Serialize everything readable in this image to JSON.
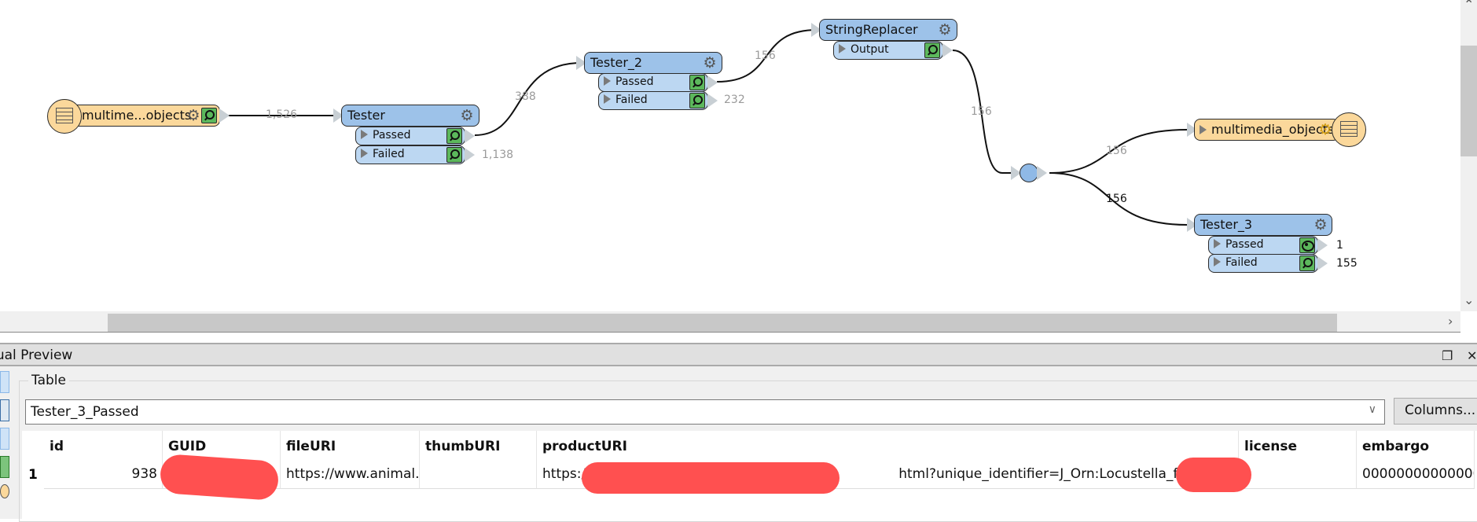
{
  "canvas": {
    "reader": {
      "label": "multime...objects",
      "count_out": "1,526"
    },
    "tester": {
      "label": "Tester",
      "ports": [
        {
          "label": "Passed",
          "count": "388"
        },
        {
          "label": "Failed",
          "count": "1,138"
        }
      ]
    },
    "tester_2": {
      "label": "Tester_2",
      "ports": [
        {
          "label": "Passed",
          "count": "156"
        },
        {
          "label": "Failed",
          "count": "232"
        }
      ]
    },
    "string_replacer": {
      "label": "StringReplacer",
      "ports": [
        {
          "label": "Output",
          "count": "156"
        }
      ]
    },
    "junction": {
      "count_up": "156",
      "count_down": "156"
    },
    "writer": {
      "label": "multimedia_objects"
    },
    "tester_3": {
      "label": "Tester_3",
      "ports": [
        {
          "label": "Passed",
          "count": "1"
        },
        {
          "label": "Failed",
          "count": "155"
        }
      ]
    }
  },
  "preview": {
    "title": "Visual Preview",
    "group_label": "Table",
    "selected_table": "Tester_3_Passed",
    "columns_button": "Columns...",
    "columns": [
      "id",
      "GUID",
      "fileURI",
      "thumbURI",
      "productURI",
      "license",
      "embargo"
    ],
    "rows": [
      {
        "num": "1",
        "id": "938",
        "GUID": "",
        "fileURI": "https://www.animal...",
        "thumbURI": "",
        "productURI_prefix": "https:/",
        "productURI_suffix": "html?unique_identifier=J_Orn:Locustella_fluviatilis",
        "license": "",
        "embargo": "00000000000000"
      }
    ]
  },
  "icons": {
    "restore": "❐",
    "close": "✕",
    "chevron_down": "∨",
    "chevron_right": "›",
    "gear": "⚙"
  }
}
